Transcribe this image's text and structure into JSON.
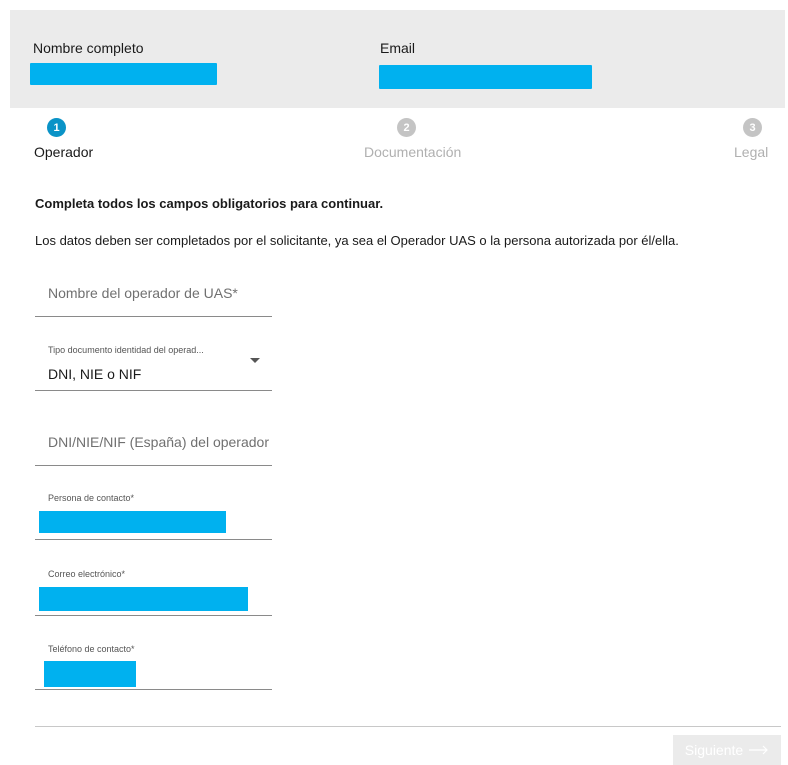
{
  "summary": {
    "name_label": "Nombre completo",
    "email_label": "Email"
  },
  "stepper": {
    "steps": [
      {
        "number": "1",
        "label": "Operador",
        "state": "active"
      },
      {
        "number": "2",
        "label": "Documentación",
        "state": "inactive"
      },
      {
        "number": "3",
        "label": "Legal",
        "state": "inactive"
      }
    ]
  },
  "intro": {
    "heading": "Completa todos los campos obligatorios para continuar.",
    "text": "Los datos deben ser completados por el solicitante, ya sea el Operador UAS o la persona autorizada por él/ella."
  },
  "form": {
    "operator_name": {
      "placeholder": "Nombre del operador de UAS*"
    },
    "doc_type": {
      "label": "Tipo documento identidad del operad...",
      "value": "DNI, NIE o NIF"
    },
    "doc_number": {
      "placeholder": "DNI/NIE/NIF (España) del operador"
    },
    "contact_person": {
      "label": "Persona de contacto*"
    },
    "email": {
      "label": "Correo electrónico*"
    },
    "phone": {
      "label": "Teléfono de contacto*"
    }
  },
  "footer": {
    "next_label": "Siguiente"
  },
  "colors": {
    "accent": "#0a93c7",
    "redaction": "#00b1ef",
    "inactive_step": "#c4c4c4",
    "summary_bg": "#ebebeb"
  }
}
